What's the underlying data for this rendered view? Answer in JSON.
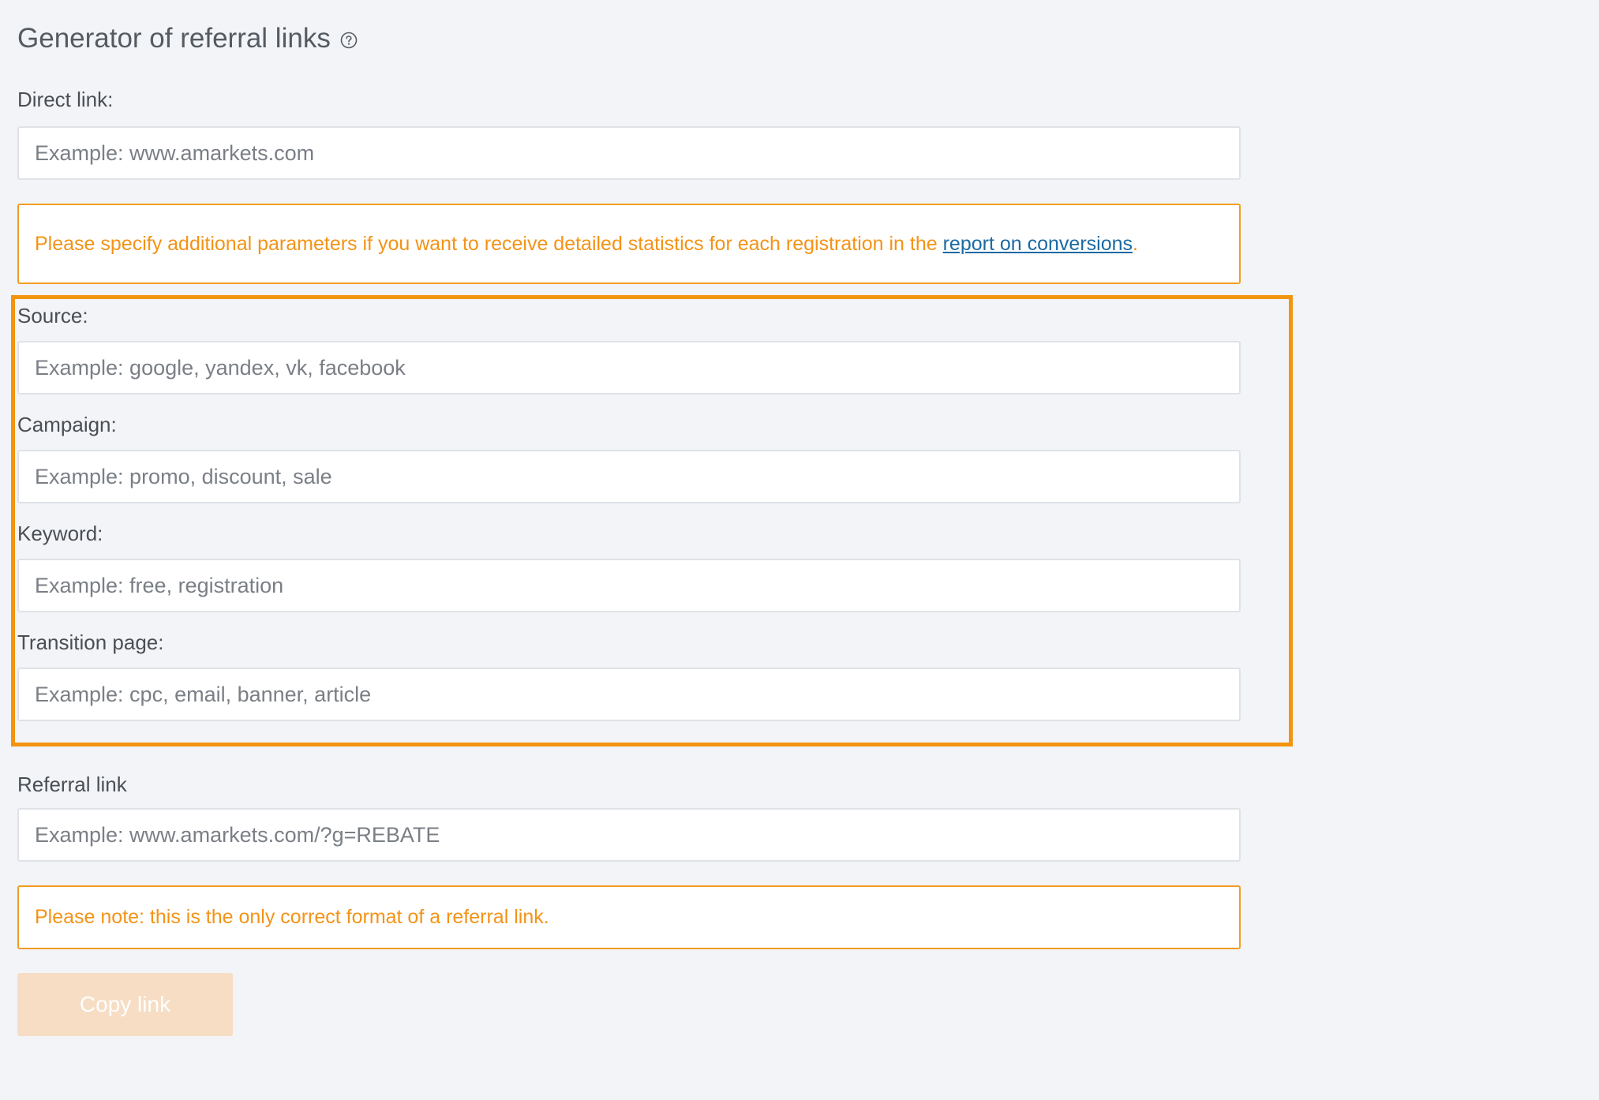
{
  "header": {
    "title": "Generator of referral links",
    "help_icon": "question-circle-icon"
  },
  "direct_link": {
    "label": "Direct link:",
    "placeholder": "Example: www.amarkets.com",
    "value": ""
  },
  "params_notice": {
    "text_before": "Please specify additional parameters if you want to receive detailed statistics for each registration in the ",
    "link_text": "report on conversions",
    "text_after": "."
  },
  "source": {
    "label": "Source:",
    "placeholder": "Example: google, yandex, vk, facebook",
    "value": ""
  },
  "campaign": {
    "label": "Campaign:",
    "placeholder": "Example: promo, discount, sale",
    "value": ""
  },
  "keyword": {
    "label": "Keyword:",
    "placeholder": "Example: free, registration",
    "value": ""
  },
  "transition_page": {
    "label": "Transition page:",
    "placeholder": "Example: cpc, email, banner, article",
    "value": ""
  },
  "referral_link": {
    "label": "Referral link",
    "placeholder": "Example: www.amarkets.com/?g=REBATE",
    "value": ""
  },
  "format_notice": {
    "text": "Please note: this is the only correct format of a referral link."
  },
  "copy_button": {
    "label": "Copy link",
    "disabled": true
  },
  "colors": {
    "background": "#f2f4f8",
    "accent_orange": "#f3940f",
    "notice_text": "#f39316",
    "link_blue": "#1b6aa3",
    "button_disabled": "#f6ddc4"
  }
}
